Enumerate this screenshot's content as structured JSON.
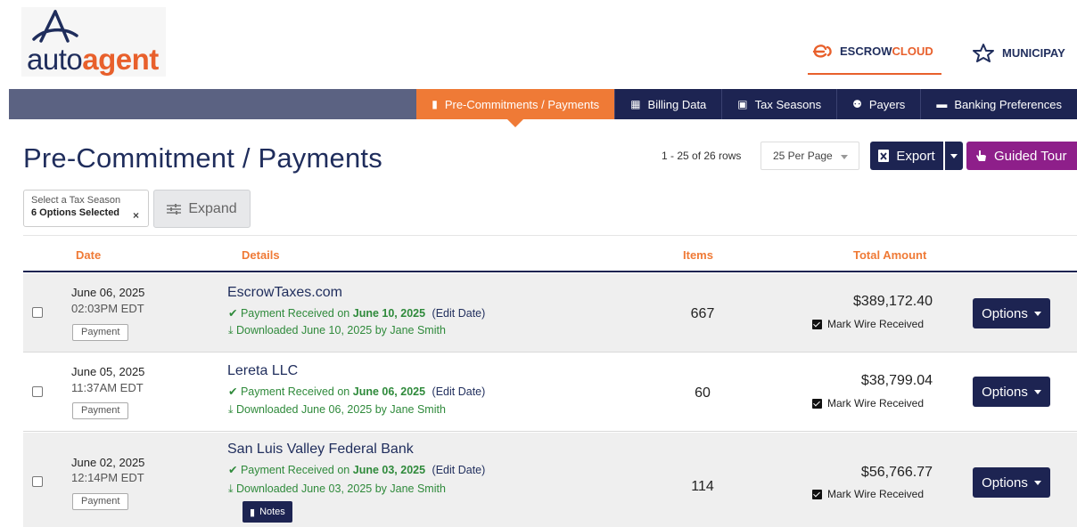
{
  "logo": {
    "part1": "auto",
    "part2": "agent"
  },
  "brands": {
    "escrow": {
      "part1": "ESCROW",
      "part2": "CLOUD"
    },
    "muni": {
      "part1": "MUNICI",
      "part2": "PAY"
    }
  },
  "nav": [
    {
      "label": "Pre-Commitments / Payments",
      "icon": "document-icon",
      "active": true
    },
    {
      "label": "Billing Data",
      "icon": "table-icon"
    },
    {
      "label": "Tax Seasons",
      "icon": "calendar-icon"
    },
    {
      "label": "Payers",
      "icon": "users-icon"
    },
    {
      "label": "Banking Preferences",
      "icon": "money-icon"
    }
  ],
  "page": {
    "title": "Pre-Commitment / Payments"
  },
  "pagination": {
    "row_count": "1 - 25 of 26 rows",
    "per_page": "25 Per Page"
  },
  "toolbar": {
    "export_label": "Export",
    "tour_label": "Guided Tour"
  },
  "filter": {
    "label": "Select a Tax Season",
    "value": "6 Options Selected",
    "clear": "×",
    "expand_label": "Expand"
  },
  "table": {
    "headers": {
      "date": "Date",
      "details": "Details",
      "items": "Items",
      "total": "Total Amount"
    },
    "rows": [
      {
        "date": "June 06, 2025",
        "time": "02:03PM EDT",
        "tag": "Payment",
        "payer": "EscrowTaxes.com",
        "status_prefix": "Payment Received on",
        "status_date": "June 10, 2025",
        "edit": "(Edit Date)",
        "download": "Downloaded June 10, 2025 by Jane Smith",
        "items": "667",
        "amount": "$389,172.40",
        "wire": "Mark Wire Received",
        "options": "Options"
      },
      {
        "date": "June 05, 2025",
        "time": "11:37AM EDT",
        "tag": "Payment",
        "payer": "Lereta LLC",
        "status_prefix": "Payment Received on",
        "status_date": "June 06, 2025",
        "edit": "(Edit Date)",
        "download": "Downloaded June 06, 2025 by Jane Smith",
        "items": "60",
        "amount": "$38,799.04",
        "wire": "Mark Wire Received",
        "options": "Options"
      },
      {
        "date": "June 02, 2025",
        "time": "12:14PM EDT",
        "tag": "Payment",
        "payer": "San Luis Valley Federal Bank",
        "status_prefix": "Payment Received on",
        "status_date": "June 03, 2025",
        "edit": "(Edit Date)",
        "download": "Downloaded June 03, 2025 by Jane Smith",
        "notes": "Notes",
        "items": "114",
        "amount": "$56,766.77",
        "wire": "Mark Wire Received",
        "options": "Options"
      }
    ]
  },
  "colors": {
    "navy": "#1d2452",
    "orange": "#ef7a36",
    "purple": "#8e1f8a",
    "green": "#2f8a3b"
  }
}
